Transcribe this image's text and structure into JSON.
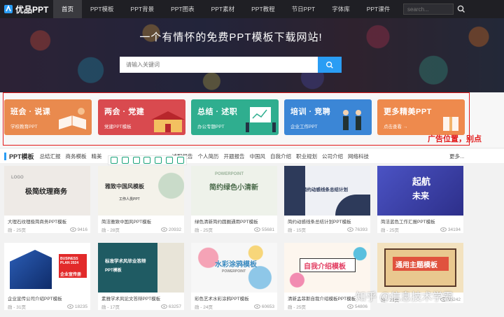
{
  "nav": {
    "logo_text": "优品PPT",
    "links": [
      "首页",
      "PPT模板",
      "PPT背景",
      "PPT图表",
      "PPT素材",
      "PPT教程",
      "节日PPT",
      "字体库",
      "PPT课件"
    ],
    "search_placeholder": "search..."
  },
  "hero": {
    "title": "一个有情怀的免费PPT模板下载网站!",
    "search_placeholder": "请输入关键词"
  },
  "ads": [
    {
      "title": "班会 · 说课",
      "sub": "学校教育PPT",
      "color": "#e98a4e"
    },
    {
      "title": "两会 · 党建",
      "sub": "党建PPT模板",
      "color": "#d94a4f"
    },
    {
      "title": "总结 · 述职",
      "sub": "办公专题PPT",
      "color": "#2fae8f"
    },
    {
      "title": "培训 · 竞聘",
      "sub": "企业工作PPT",
      "color": "#3b86d6"
    },
    {
      "title": "更多精美PPT",
      "sub": "点击查看 →",
      "color": "#ee8a4d"
    }
  ],
  "ad_note": "广告位置，别点",
  "category": {
    "title": "PPT模板",
    "items": [
      "总结汇报",
      "商务模板",
      "精美",
      "",
      "",
      "",
      "述职报告",
      "个人简历",
      "开题报告",
      "中国风",
      "自我介绍",
      "职业规划",
      "公司介绍",
      "网络科技"
    ],
    "more": "更多..."
  },
  "cards": [
    {
      "name": "大理石纹理极简商务PPT模板",
      "format": "勋",
      "pages": "25页",
      "views": "9416",
      "thumb_text": "极简纹理商务",
      "thumb_sub": "LOGO"
    },
    {
      "name": "简洁雅致中国风PPT模板",
      "format": "勋",
      "pages": "28页",
      "views": "20932",
      "thumb_text": "雅致中国风模板",
      "thumb_sub": "工作人员PPT"
    },
    {
      "name": "绿色清新简约圆圈通用PPT模板",
      "format": "勋",
      "pages": "25页",
      "views": "55681",
      "thumb_text": "简约绿色小清新",
      "thumb_sub": "POWERPOINT"
    },
    {
      "name": "简约动感线条总结计划PPT模板",
      "format": "勋",
      "pages": "15页",
      "views": "76393",
      "thumb_text": "简约动感线条总结计划",
      "thumb_sub": ""
    },
    {
      "name": "简洁蓝色工作汇报PPT模板",
      "format": "勋",
      "pages": "25页",
      "views": "34194",
      "thumb_text": "起航",
      "thumb_sub": "未来"
    },
    {
      "name": "企业宣传公司介绍PPT模板",
      "format": "勋",
      "pages": "31页",
      "views": "18235",
      "thumb_text": "BUSINESS PLAN 2024",
      "thumb_sub": "企业宣传册"
    },
    {
      "name": "素雅学术风论文答辩PPT模板",
      "format": "勋",
      "pages": "17页",
      "views": "63257",
      "thumb_text": "标准学术风毕业答辩",
      "thumb_sub": "PPT模板"
    },
    {
      "name": "彩色艺术水彩涂鸦PPT模板",
      "format": "勋",
      "pages": "24页",
      "views": "60653",
      "thumb_text": "水彩涂鸦模板",
      "thumb_sub": "POWERPOINT"
    },
    {
      "name": "清新孟菲斯自我介绍模板PPT模板",
      "format": "勋",
      "pages": "25页",
      "views": "54806",
      "thumb_text": "自我介绍模板",
      "thumb_sub": ""
    },
    {
      "name": "",
      "format": "勋",
      "pages": "25页",
      "views": "55242",
      "thumb_text": "通用主题模板",
      "thumb_sub": ""
    }
  ],
  "watermark": "知乎 @信息技术学霸"
}
